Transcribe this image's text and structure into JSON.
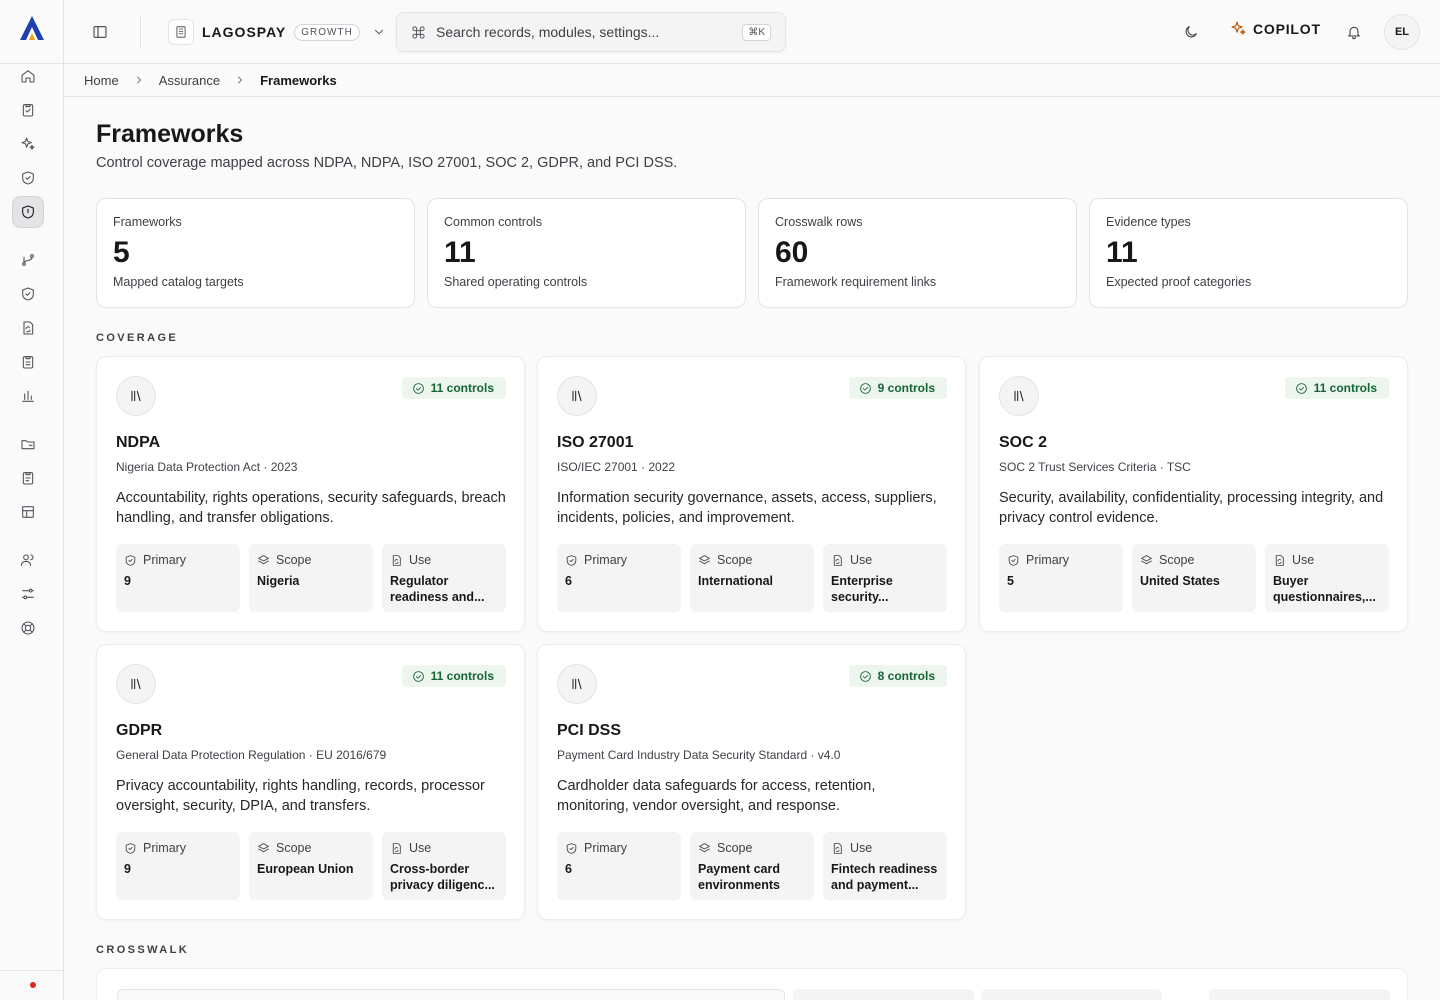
{
  "org": {
    "name": "LAGOSPAY",
    "plan": "GROWTH"
  },
  "search": {
    "placeholder": "Search records, modules, settings...",
    "shortcut": "⌘K"
  },
  "header": {
    "copilot_label": "COPILOT",
    "avatar_initials": "EL"
  },
  "breadcrumb": [
    "Home",
    "Assurance",
    "Frameworks"
  ],
  "page": {
    "title": "Frameworks",
    "subtitle": "Control coverage mapped across NDPA, NDPA, ISO 27001, SOC 2, GDPR, and PCI DSS."
  },
  "stats": [
    {
      "label": "Frameworks",
      "value": "5",
      "desc": "Mapped catalog targets"
    },
    {
      "label": "Common controls",
      "value": "11",
      "desc": "Shared operating controls"
    },
    {
      "label": "Crosswalk rows",
      "value": "60",
      "desc": "Framework requirement links"
    },
    {
      "label": "Evidence types",
      "value": "11",
      "desc": "Expected proof categories"
    }
  ],
  "sections": {
    "coverage": "COVERAGE",
    "crosswalk": "CROSSWALK"
  },
  "meta_labels": {
    "primary": "Primary",
    "scope": "Scope",
    "use": "Use"
  },
  "frameworks": [
    {
      "name": "NDPA",
      "meta": "Nigeria Data Protection Act · 2023",
      "controls": "11 controls",
      "desc": "Accountability, rights operations, security safeguards, breach handling, and transfer obligations.",
      "primary": "9",
      "scope": "Nigeria",
      "use": "Regulator readiness and..."
    },
    {
      "name": "ISO 27001",
      "meta": "ISO/IEC 27001 · 2022",
      "controls": "9 controls",
      "desc": "Information security governance, assets, access, suppliers, incidents, policies, and improvement.",
      "primary": "6",
      "scope": "International",
      "use": "Enterprise security..."
    },
    {
      "name": "SOC 2",
      "meta": "SOC 2 Trust Services Criteria · TSC",
      "controls": "11 controls",
      "desc": "Security, availability, confidentiality, processing integrity, and privacy control evidence.",
      "primary": "5",
      "scope": "United States",
      "use": "Buyer questionnaires,..."
    },
    {
      "name": "GDPR",
      "meta": "General Data Protection Regulation · EU 2016/679",
      "controls": "11 controls",
      "desc": "Privacy accountability, rights handling, records, processor oversight, security, DPIA, and transfers.",
      "primary": "9",
      "scope": "European Union",
      "use": "Cross-border privacy diligenc..."
    },
    {
      "name": "PCI DSS",
      "meta": "Payment Card Industry Data Security Standard · v4.0",
      "controls": "8 controls",
      "desc": "Cardholder data safeguards for access, retention, monitoring, vendor oversight, and response.",
      "primary": "6",
      "scope": "Payment card environments",
      "use": "Fintech readiness and payment..."
    }
  ],
  "colors": {
    "badge_bg": "#ecf5ee",
    "badge_text": "#166534",
    "accent_blue": "#1e40af",
    "accent_orange": "#f59e0b",
    "alert_dot": "#dc2626"
  },
  "icons": {
    "rail": [
      "home-icon",
      "clipboard-check-icon",
      "sparkles-icon",
      "shield-check-icon",
      "shield-icon",
      "git-branch-icon",
      "shield-check-icon",
      "file-sync-icon",
      "clipboard-list-icon",
      "bar-chart-icon",
      "folder-icon",
      "clipboard-icon",
      "table-icon",
      "users-icon",
      "sliders-icon",
      "life-buoy-icon"
    ],
    "framework": "library-icon"
  }
}
